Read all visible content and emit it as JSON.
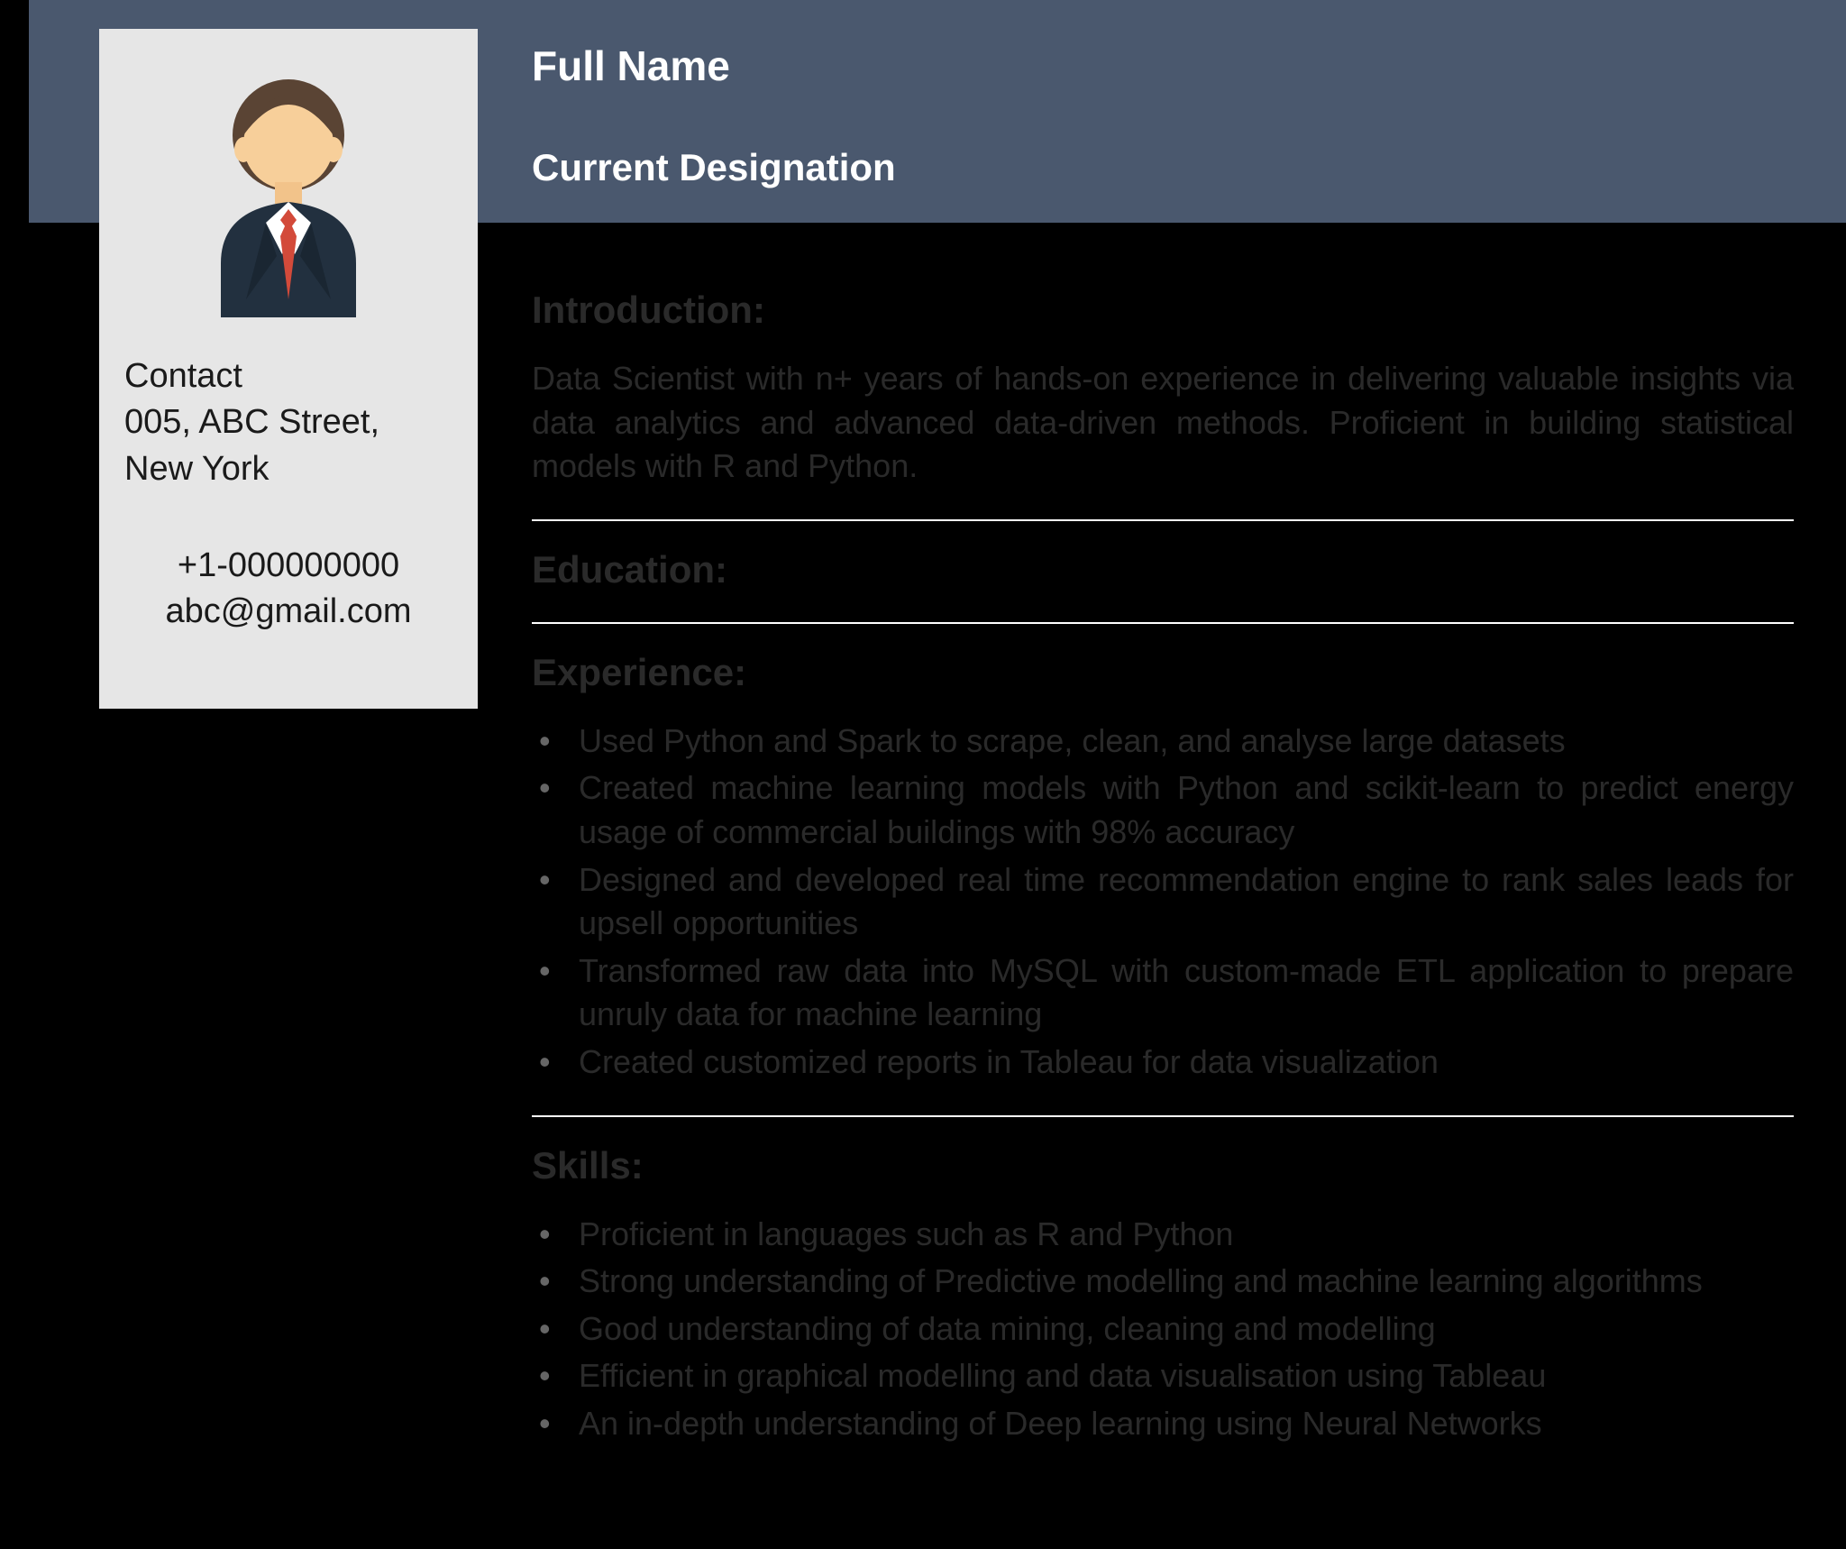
{
  "header": {
    "full_name": "Full Name",
    "designation": "Current Designation"
  },
  "contact": {
    "label": "Contact",
    "address_line1": "005, ABC Street,",
    "address_line2": "New York",
    "phone": "+1-000000000",
    "email": "abc@gmail.com"
  },
  "sections": {
    "intro": {
      "heading": "Introduction:",
      "text": "Data Scientist with n+ years of hands-on experience in delivering valuable insights via data analytics and advanced data-driven methods. Proficient in building statistical models with  R and Python."
    },
    "education": {
      "heading": "Education:"
    },
    "experience": {
      "heading": "Experience:",
      "items": [
        "Used Python and Spark to scrape, clean, and analyse large datasets",
        "Created machine learning models with Python and scikit-learn to predict energy usage of commercial buildings with 98% accuracy",
        "Designed and developed real time recommendation engine to rank sales leads for upsell opportunities",
        "Transformed raw data into MySQL with custom-made ETL application to prepare unruly data for machine learning",
        "Created customized reports in Tableau for data visualization"
      ]
    },
    "skills": {
      "heading": "Skills:",
      "items": [
        "Proficient in languages such as R and Python",
        "Strong understanding of Predictive modelling and machine learning algorithms",
        "Good understanding of data mining, cleaning and modelling",
        "Efficient in graphical modelling and data visualisation using Tableau",
        "An in-depth understanding of Deep learning using Neural Networks"
      ]
    }
  }
}
